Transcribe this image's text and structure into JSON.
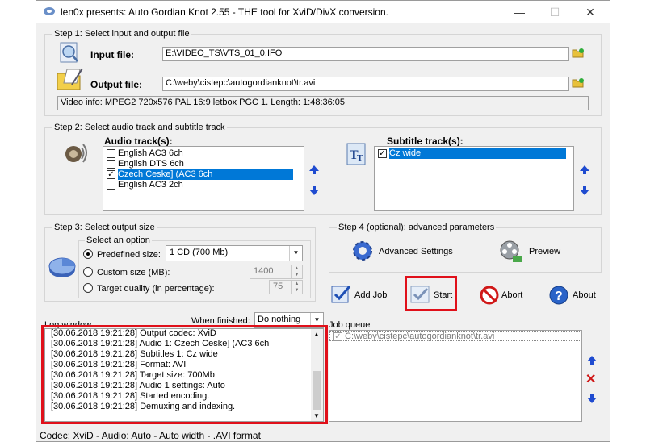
{
  "window": {
    "title": "len0x presents: Auto Gordian Knot 2.55 - THE tool for XviD/DivX conversion.",
    "minimize": "—",
    "maximize": "☐",
    "close": "✕"
  },
  "step1": {
    "label": "Step 1: Select input and output file",
    "input_label": "Input file:",
    "input_value": "E:\\VIDEO_TS\\VTS_01_0.IFO",
    "output_label": "Output file:",
    "output_value": "C:\\weby\\cistepc\\autogordianknot\\tr.avi",
    "video_info": "Video info: MPEG2 720x576 PAL 16:9 letbox  PGC 1. Length: 1:48:36:05"
  },
  "step2": {
    "label": "Step 2: Select audio track and subtitle track",
    "audio_label": "Audio track(s):",
    "audio_tracks": [
      {
        "label": "English AC3 6ch",
        "checked": false,
        "selected": false
      },
      {
        "label": "English DTS 6ch",
        "checked": false,
        "selected": false
      },
      {
        "label": "Czech Ceske] (AC3 6ch",
        "checked": true,
        "selected": true
      },
      {
        "label": "English AC3 2ch",
        "checked": false,
        "selected": false
      }
    ],
    "subtitle_label": "Subtitle track(s):",
    "subtitle_tracks": [
      {
        "label": "Cz wide",
        "checked": true,
        "selected": true
      }
    ]
  },
  "step3": {
    "label": "Step 3: Select output size",
    "option_label": "Select an option",
    "predefined_label": "Predefined size:",
    "predefined_value": "1 CD (700 Mb)",
    "custom_label": "Custom size (MB):",
    "custom_value": "1400",
    "quality_label": "Target quality (in percentage):",
    "quality_value": "75"
  },
  "step4": {
    "label": "Step 4 (optional): advanced parameters",
    "advanced_label": "Advanced Settings",
    "preview_label": "Preview"
  },
  "actions": {
    "add_job": "Add Job",
    "start": "Start",
    "abort": "Abort",
    "about": "About"
  },
  "log": {
    "label": "Log window",
    "when_finished_label": "When finished:",
    "when_finished_value": "Do nothing",
    "lines": [
      "[30.06.2018 19:21:28] Output codec: XviD",
      "[30.06.2018 19:21:28] Audio 1: Czech Ceske] (AC3 6ch",
      "[30.06.2018 19:21:28] Subtitles 1: Cz wide",
      "[30.06.2018 19:21:28] Format: AVI",
      "[30.06.2018 19:21:28] Target size: 700Mb",
      "[30.06.2018 19:21:28] Audio 1 settings: Auto",
      "[30.06.2018 19:21:28] Started encoding.",
      "[30.06.2018 19:21:28] Demuxing and indexing."
    ]
  },
  "job_queue": {
    "label": "Job queue",
    "items": [
      "C:\\weby\\cistepc\\autogordianknot\\tr.avi"
    ]
  },
  "statusbar": {
    "text": "Codec: XviD -  Audio: Auto -  Auto width - .AVI format"
  },
  "colors": {
    "highlight": "#0078d7",
    "red_box": "#e0101a",
    "arrow_blue": "#1f4bd0"
  }
}
